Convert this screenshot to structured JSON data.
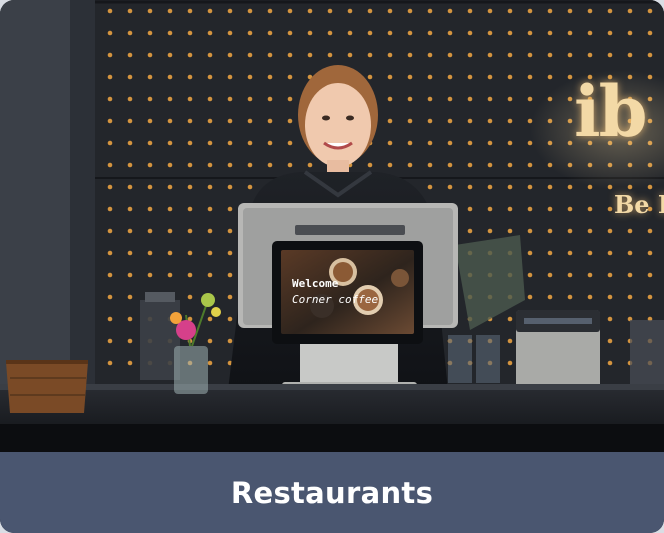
{
  "caption": {
    "label": "Restaurants"
  },
  "sign": {
    "brand": "ib",
    "tagline": "Be I"
  },
  "pos_screen": {
    "title": "Welcome",
    "subtitle": "Corner coffee"
  },
  "colors": {
    "caption_bar": "#4a5670",
    "caption_text": "#ffffff",
    "wall": "#23262b",
    "dot_light": "#f2a742",
    "counter": "#1a1c20"
  }
}
